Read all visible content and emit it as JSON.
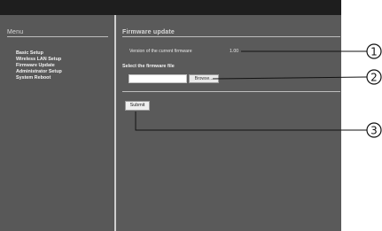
{
  "sidebar": {
    "title": "Menu",
    "items": [
      {
        "label": "Basic Setup"
      },
      {
        "label": "Wireless LAN Setup"
      },
      {
        "label": "Firmware Update"
      },
      {
        "label": "Administrator Setup"
      },
      {
        "label": "System Reboot"
      }
    ]
  },
  "main": {
    "title": "Firmware update",
    "current_version_label": "Version of the current firmware",
    "current_version_value": "1.00",
    "select_file_label": "Select the firmware file",
    "file_input_value": "",
    "browse_label": "Browse...",
    "submit_label": "Submit"
  },
  "callouts": [
    "1",
    "2",
    "3"
  ],
  "colors": {
    "topbar": "#1e1e1e",
    "background": "#5a5a5a",
    "divider": "#cfcfcf"
  }
}
